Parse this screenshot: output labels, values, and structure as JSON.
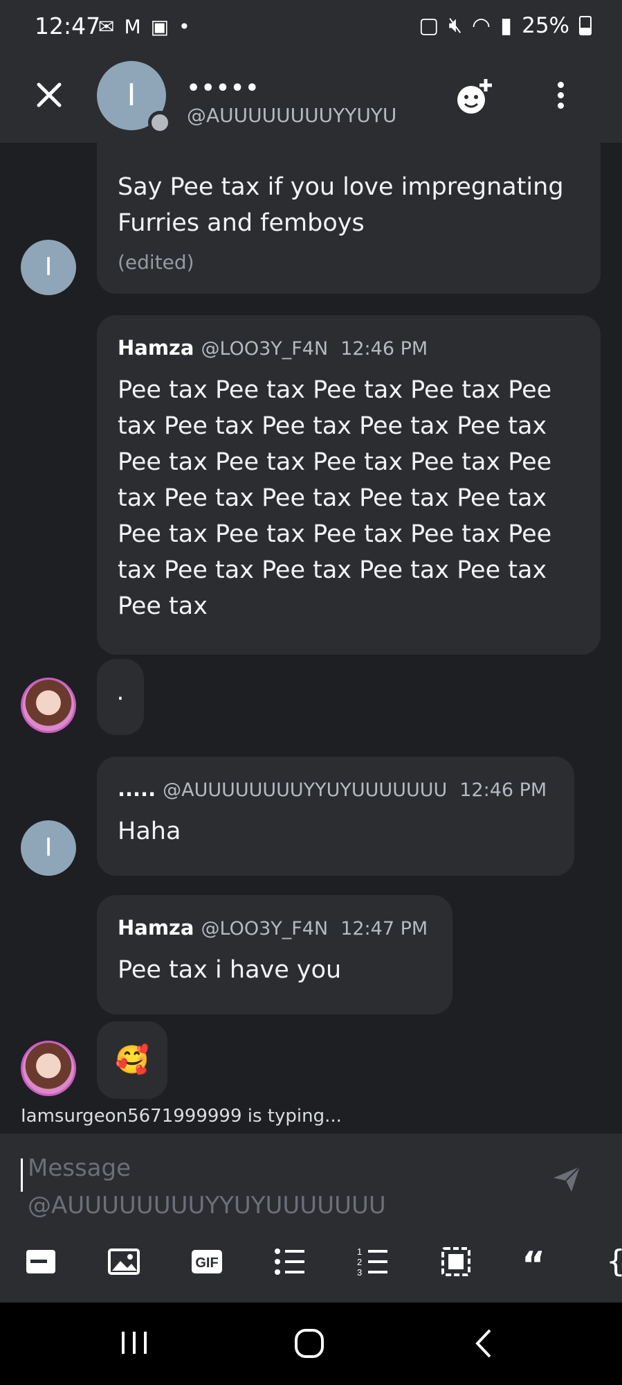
{
  "status_bar": {
    "time": "12:47",
    "battery": "25%",
    "left_icons": [
      "notification-icon",
      "gmail-icon",
      "gallery-icon",
      "dot-icon"
    ],
    "right_icons": [
      "battery-saver-icon",
      "mute-icon",
      "wifi-icon",
      "signal-icon"
    ]
  },
  "header": {
    "avatar_letter": "I",
    "name": "•••••",
    "handle": "@AUUUUUUUUYYUYU"
  },
  "messages": [
    {
      "author": "",
      "handle": "",
      "time": "",
      "text": "Say Pee tax if you love impregnating Furries and femboys",
      "edited": "(edited)",
      "avatar_letter": "I"
    },
    {
      "author": "Hamza",
      "handle": "@LOO3Y_F4N",
      "time": "12:46 PM",
      "text": "Pee tax Pee tax Pee tax Pee tax Pee tax Pee tax Pee tax Pee tax Pee tax Pee tax Pee tax Pee tax Pee tax Pee tax Pee tax Pee tax Pee tax Pee tax Pee tax Pee tax Pee tax Pee tax Pee tax Pee tax Pee tax Pee tax Pee tax Pee tax"
    },
    {
      "author": "",
      "handle": "",
      "time": "",
      "text": "."
    },
    {
      "author": ".....",
      "handle": "@AUUUUUUUUYYUYUUUUUUU",
      "time": "12:46 PM",
      "text": "Haha",
      "avatar_letter": "I"
    },
    {
      "author": "Hamza",
      "handle": "@LOO3Y_F4N",
      "time": "12:47 PM",
      "text": "Pee tax i have you"
    },
    {
      "author": "",
      "handle": "",
      "time": "",
      "text": "🥰"
    }
  ],
  "typing": "Iamsurgeon5671999999 is typing...",
  "composer": {
    "placeholder_line1": "Message",
    "placeholder_line2": "@AUUUUUUUUYYUYUUUUUUU"
  },
  "toolbar": {
    "code_label": "{",
    "quote_label": "“"
  },
  "colors": {
    "background": "#1e1f22",
    "bubble": "#2b2d31",
    "avatar": "#8ea6b8"
  }
}
